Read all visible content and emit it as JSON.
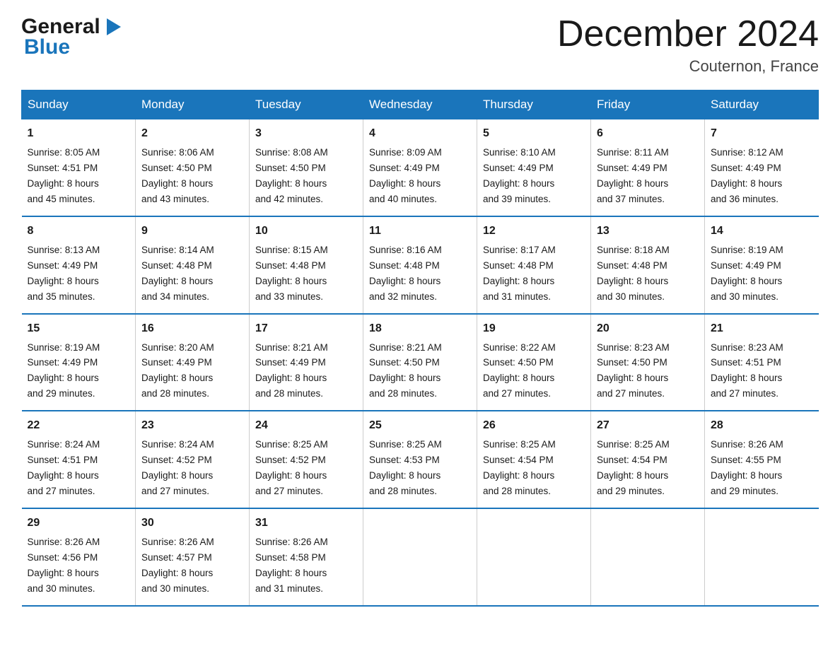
{
  "header": {
    "logo": {
      "general": "General",
      "blue": "Blue"
    },
    "title": "December 2024",
    "location": "Couternon, France"
  },
  "calendar": {
    "days_header": [
      "Sunday",
      "Monday",
      "Tuesday",
      "Wednesday",
      "Thursday",
      "Friday",
      "Saturday"
    ],
    "weeks": [
      [
        {
          "day": "1",
          "sunrise": "8:05 AM",
          "sunset": "4:51 PM",
          "daylight": "8 hours and 45 minutes."
        },
        {
          "day": "2",
          "sunrise": "8:06 AM",
          "sunset": "4:50 PM",
          "daylight": "8 hours and 43 minutes."
        },
        {
          "day": "3",
          "sunrise": "8:08 AM",
          "sunset": "4:50 PM",
          "daylight": "8 hours and 42 minutes."
        },
        {
          "day": "4",
          "sunrise": "8:09 AM",
          "sunset": "4:49 PM",
          "daylight": "8 hours and 40 minutes."
        },
        {
          "day": "5",
          "sunrise": "8:10 AM",
          "sunset": "4:49 PM",
          "daylight": "8 hours and 39 minutes."
        },
        {
          "day": "6",
          "sunrise": "8:11 AM",
          "sunset": "4:49 PM",
          "daylight": "8 hours and 37 minutes."
        },
        {
          "day": "7",
          "sunrise": "8:12 AM",
          "sunset": "4:49 PM",
          "daylight": "8 hours and 36 minutes."
        }
      ],
      [
        {
          "day": "8",
          "sunrise": "8:13 AM",
          "sunset": "4:49 PM",
          "daylight": "8 hours and 35 minutes."
        },
        {
          "day": "9",
          "sunrise": "8:14 AM",
          "sunset": "4:48 PM",
          "daylight": "8 hours and 34 minutes."
        },
        {
          "day": "10",
          "sunrise": "8:15 AM",
          "sunset": "4:48 PM",
          "daylight": "8 hours and 33 minutes."
        },
        {
          "day": "11",
          "sunrise": "8:16 AM",
          "sunset": "4:48 PM",
          "daylight": "8 hours and 32 minutes."
        },
        {
          "day": "12",
          "sunrise": "8:17 AM",
          "sunset": "4:48 PM",
          "daylight": "8 hours and 31 minutes."
        },
        {
          "day": "13",
          "sunrise": "8:18 AM",
          "sunset": "4:48 PM",
          "daylight": "8 hours and 30 minutes."
        },
        {
          "day": "14",
          "sunrise": "8:19 AM",
          "sunset": "4:49 PM",
          "daylight": "8 hours and 30 minutes."
        }
      ],
      [
        {
          "day": "15",
          "sunrise": "8:19 AM",
          "sunset": "4:49 PM",
          "daylight": "8 hours and 29 minutes."
        },
        {
          "day": "16",
          "sunrise": "8:20 AM",
          "sunset": "4:49 PM",
          "daylight": "8 hours and 28 minutes."
        },
        {
          "day": "17",
          "sunrise": "8:21 AM",
          "sunset": "4:49 PM",
          "daylight": "8 hours and 28 minutes."
        },
        {
          "day": "18",
          "sunrise": "8:21 AM",
          "sunset": "4:50 PM",
          "daylight": "8 hours and 28 minutes."
        },
        {
          "day": "19",
          "sunrise": "8:22 AM",
          "sunset": "4:50 PM",
          "daylight": "8 hours and 27 minutes."
        },
        {
          "day": "20",
          "sunrise": "8:23 AM",
          "sunset": "4:50 PM",
          "daylight": "8 hours and 27 minutes."
        },
        {
          "day": "21",
          "sunrise": "8:23 AM",
          "sunset": "4:51 PM",
          "daylight": "8 hours and 27 minutes."
        }
      ],
      [
        {
          "day": "22",
          "sunrise": "8:24 AM",
          "sunset": "4:51 PM",
          "daylight": "8 hours and 27 minutes."
        },
        {
          "day": "23",
          "sunrise": "8:24 AM",
          "sunset": "4:52 PM",
          "daylight": "8 hours and 27 minutes."
        },
        {
          "day": "24",
          "sunrise": "8:25 AM",
          "sunset": "4:52 PM",
          "daylight": "8 hours and 27 minutes."
        },
        {
          "day": "25",
          "sunrise": "8:25 AM",
          "sunset": "4:53 PM",
          "daylight": "8 hours and 28 minutes."
        },
        {
          "day": "26",
          "sunrise": "8:25 AM",
          "sunset": "4:54 PM",
          "daylight": "8 hours and 28 minutes."
        },
        {
          "day": "27",
          "sunrise": "8:25 AM",
          "sunset": "4:54 PM",
          "daylight": "8 hours and 29 minutes."
        },
        {
          "day": "28",
          "sunrise": "8:26 AM",
          "sunset": "4:55 PM",
          "daylight": "8 hours and 29 minutes."
        }
      ],
      [
        {
          "day": "29",
          "sunrise": "8:26 AM",
          "sunset": "4:56 PM",
          "daylight": "8 hours and 30 minutes."
        },
        {
          "day": "30",
          "sunrise": "8:26 AM",
          "sunset": "4:57 PM",
          "daylight": "8 hours and 30 minutes."
        },
        {
          "day": "31",
          "sunrise": "8:26 AM",
          "sunset": "4:58 PM",
          "daylight": "8 hours and 31 minutes."
        },
        null,
        null,
        null,
        null
      ]
    ],
    "labels": {
      "sunrise": "Sunrise:",
      "sunset": "Sunset:",
      "daylight": "Daylight:"
    }
  }
}
